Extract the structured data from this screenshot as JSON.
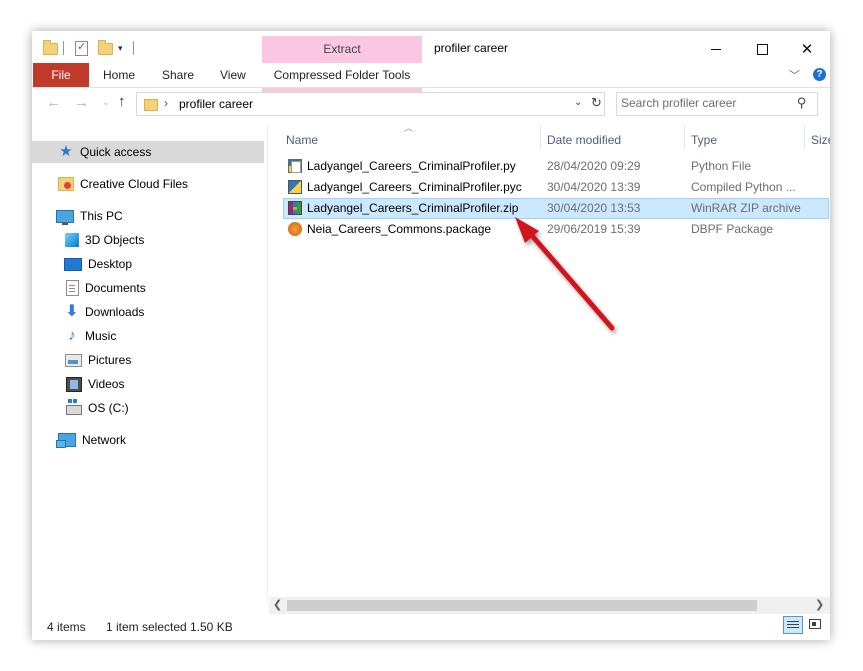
{
  "window": {
    "title": "profiler career"
  },
  "ribbon": {
    "contextual_group": "Extract",
    "tabs": {
      "file": "File",
      "home": "Home",
      "share": "Share",
      "view": "View",
      "compressed_folder_tools": "Compressed Folder Tools"
    },
    "help_glyph": "?"
  },
  "window_controls": {
    "minimize_icon": "minimize-icon",
    "maximize_icon": "maximize-icon",
    "close_glyph": "✕"
  },
  "address_bar": {
    "path": "profiler career",
    "separator": "›"
  },
  "search": {
    "placeholder": "Search profiler career"
  },
  "sidebar": {
    "items": [
      {
        "label": "Quick access",
        "icon": "star-icon",
        "selected": true
      },
      {
        "label": "Creative Cloud Files",
        "icon": "creative-cloud-folder-icon"
      },
      {
        "label": "This PC",
        "icon": "computer-icon"
      },
      {
        "label": "3D Objects",
        "icon": "3d-objects-icon"
      },
      {
        "label": "Desktop",
        "icon": "desktop-icon"
      },
      {
        "label": "Documents",
        "icon": "documents-icon"
      },
      {
        "label": "Downloads",
        "icon": "downloads-icon"
      },
      {
        "label": "Music",
        "icon": "music-icon"
      },
      {
        "label": "Pictures",
        "icon": "pictures-icon"
      },
      {
        "label": "Videos",
        "icon": "videos-icon"
      },
      {
        "label": "OS (C:)",
        "icon": "drive-icon"
      },
      {
        "label": "Network",
        "icon": "network-icon"
      }
    ]
  },
  "file_list": {
    "columns": {
      "name": "Name",
      "date_modified": "Date modified",
      "type": "Type",
      "size": "Size"
    },
    "rows": [
      {
        "name": "Ladyangel_Careers_CriminalProfiler.py",
        "date_modified": "28/04/2020 09:29",
        "type": "Python File",
        "icon": "python-file-icon"
      },
      {
        "name": "Ladyangel_Careers_CriminalProfiler.pyc",
        "date_modified": "30/04/2020 13:39",
        "type": "Compiled Python ...",
        "icon": "compiled-python-icon"
      },
      {
        "name": "Ladyangel_Careers_CriminalProfiler.zip",
        "date_modified": "30/04/2020 13:53",
        "type": "WinRAR ZIP archive",
        "icon": "winrar-zip-icon",
        "selected": true
      },
      {
        "name": "Neia_Careers_Commons.package",
        "date_modified": "29/06/2019 15:39",
        "type": "DBPF Package",
        "icon": "package-icon"
      }
    ]
  },
  "status_bar": {
    "item_count": "4 items",
    "selection": "1 item selected",
    "size": "1.50 KB"
  },
  "colors": {
    "file_tab": "#c0392b",
    "contextual_tab": "#f9c7e1",
    "selection_bg": "#cce8ff",
    "annotation_arrow": "#d0161c"
  }
}
